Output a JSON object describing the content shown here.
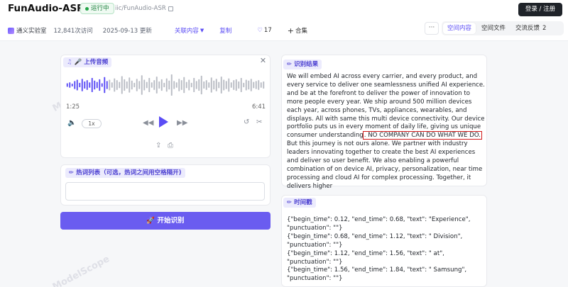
{
  "header": {
    "title": "FunAudio-ASR",
    "status": "运行中",
    "repo_path": "iic/FunAudio-ASR",
    "login": "登录 / 注册",
    "org": "通义实验室",
    "visits": "12,841次访问",
    "date": "2025-09-13 更新",
    "related": "关联内容",
    "copy": "复制",
    "likes": "17",
    "collect": "合集",
    "more": "···",
    "tabs": [
      {
        "label": "空间内容",
        "active": true
      },
      {
        "label": "空间文件",
        "active": false
      },
      {
        "label": "交流反馈",
        "count": "2",
        "active": false
      }
    ]
  },
  "watermark": "ModelScope",
  "audio": {
    "label": "上传音频",
    "current_time": "1:25",
    "total_time": "6:41",
    "speed": "1x",
    "progress": 0.212,
    "waveform": [
      4,
      6,
      3,
      9,
      12,
      5,
      14,
      8,
      11,
      6,
      16,
      10,
      7,
      13,
      4,
      18,
      9,
      12,
      6,
      15,
      11,
      7,
      20,
      13,
      8,
      17,
      10,
      5,
      14,
      9,
      22,
      12,
      7,
      16,
      6,
      11,
      19,
      8,
      13,
      5,
      15,
      10,
      24,
      9,
      6,
      14,
      11,
      18,
      7,
      12,
      5,
      16,
      9,
      13,
      21,
      8,
      11,
      6,
      17,
      10,
      14,
      7,
      19,
      12,
      9,
      15,
      6,
      11,
      13,
      8,
      16,
      5,
      12,
      10,
      14,
      7,
      9,
      11,
      6,
      8
    ]
  },
  "hotwords": {
    "label": "热词列表（可选，热词之间用空格隔开)",
    "value": ""
  },
  "start_button": "🚀 开始识别",
  "result": {
    "label": "识别结果",
    "text_before": "We will embed AI across every carrier, and every product, and every service to deliver one seamlessness unified AI experience. and be at the forefront to deliver the power of innovation to more people every year. We ship around 500 million devices each year, across phones, TVs, appliances, wearables, and displays. All with same this multi device connectivity. Our device portfolio puts us in every moment of daily life, giving us unique consumer understanding",
    "text_highlight": ". NO COMPANY CAN DO WHAT WE DO.",
    "text_after": " But this journey is not ours alone. We partner with industry leaders innovating together to create the best AI experiences and deliver so user benefit. We also enabling a powerful combination of on device AI, privacy, personalization, near time processing and cloud AI for complex processing. Together, it delivers higher"
  },
  "timestamps": {
    "label": "时间戳",
    "lines": [
      "{\"begin_time\": 0.12, \"end_time\": 0.68, \"text\": \"Experience\", \"punctuation\": \"\"}",
      "{\"begin_time\": 0.68, \"end_time\": 1.12, \"text\": \" Division\", \"punctuation\": \"\"}",
      "{\"begin_time\": 1.12, \"end_time\": 1.56, \"text\": \" at\", \"punctuation\": \"\"}",
      "{\"begin_time\": 1.56, \"end_time\": 1.84, \"text\": \" Samsung\", \"punctuation\": \"\"}"
    ]
  },
  "colors": {
    "accent": "#5b4df5",
    "wave_played": "#5b4df5",
    "wave_unplayed": "#b9bcc4",
    "highlight_box": "#d11a1a"
  }
}
